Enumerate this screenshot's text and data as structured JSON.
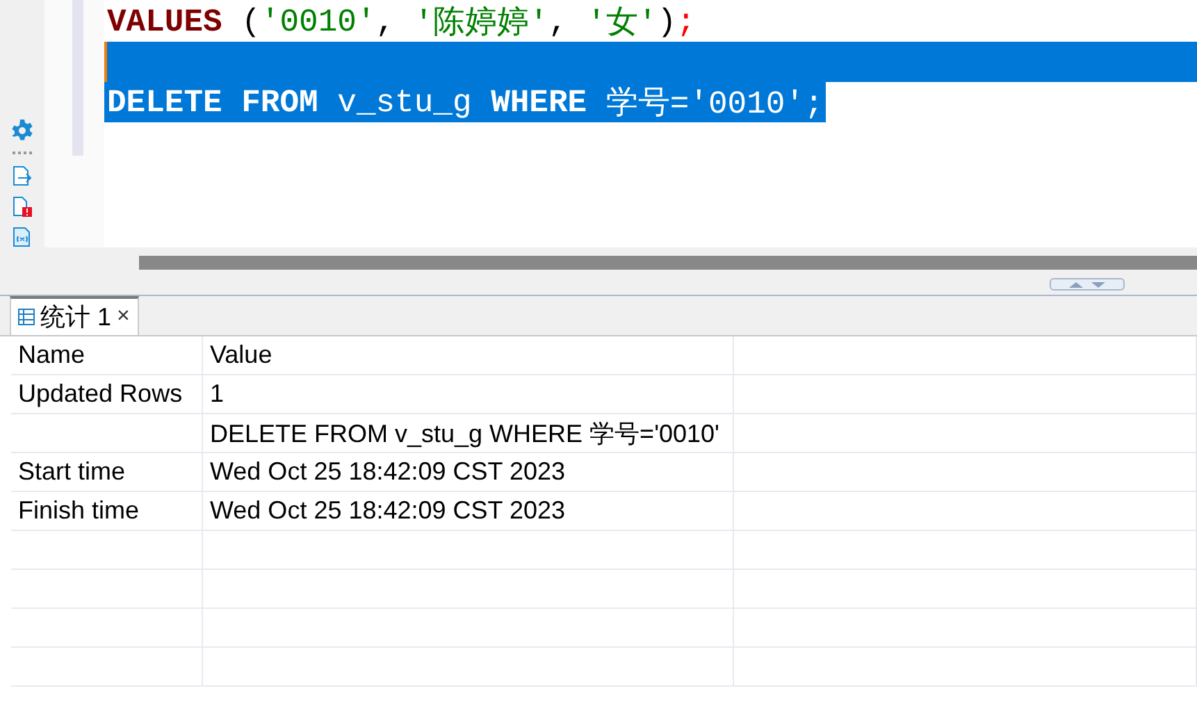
{
  "editor": {
    "lines": [
      {
        "selected": false,
        "tokens": [
          {
            "kind": "keyword",
            "text": "VALUES"
          },
          {
            "kind": "punct",
            "text": " ("
          },
          {
            "kind": "string",
            "text": "'0010'"
          },
          {
            "kind": "punct",
            "text": ", "
          },
          {
            "kind": "string",
            "text": "'陈婷婷'"
          },
          {
            "kind": "punct",
            "text": ", "
          },
          {
            "kind": "string",
            "text": "'女'"
          },
          {
            "kind": "punct",
            "text": ")"
          },
          {
            "kind": "error",
            "text": ";"
          }
        ]
      },
      {
        "selected": true
      },
      {
        "selected": true,
        "tokens": [
          {
            "kind": "keyword",
            "text": "DELETE"
          },
          {
            "kind": "keyword",
            "text": " FROM"
          },
          {
            "kind": "plain",
            "text": " v_stu_g "
          },
          {
            "kind": "keyword",
            "text": "WHERE"
          },
          {
            "kind": "plain",
            "text": " 学号='0010';"
          }
        ]
      }
    ]
  },
  "results": {
    "tab": {
      "label": "统计 1",
      "close": "×",
      "selected": true
    },
    "columns": [
      "Name",
      "Value"
    ],
    "rows": [
      {
        "name": "Updated Rows",
        "value": "1"
      },
      {
        "value": "DELETE FROM v_stu_g WHERE 学号='0010'"
      },
      {
        "name": "Start time",
        "value": "Wed Oct 25 18:42:09 CST 2023"
      },
      {
        "name": "Finish time",
        "value": "Wed Oct 25 18:42:09 CST 2023"
      }
    ]
  }
}
